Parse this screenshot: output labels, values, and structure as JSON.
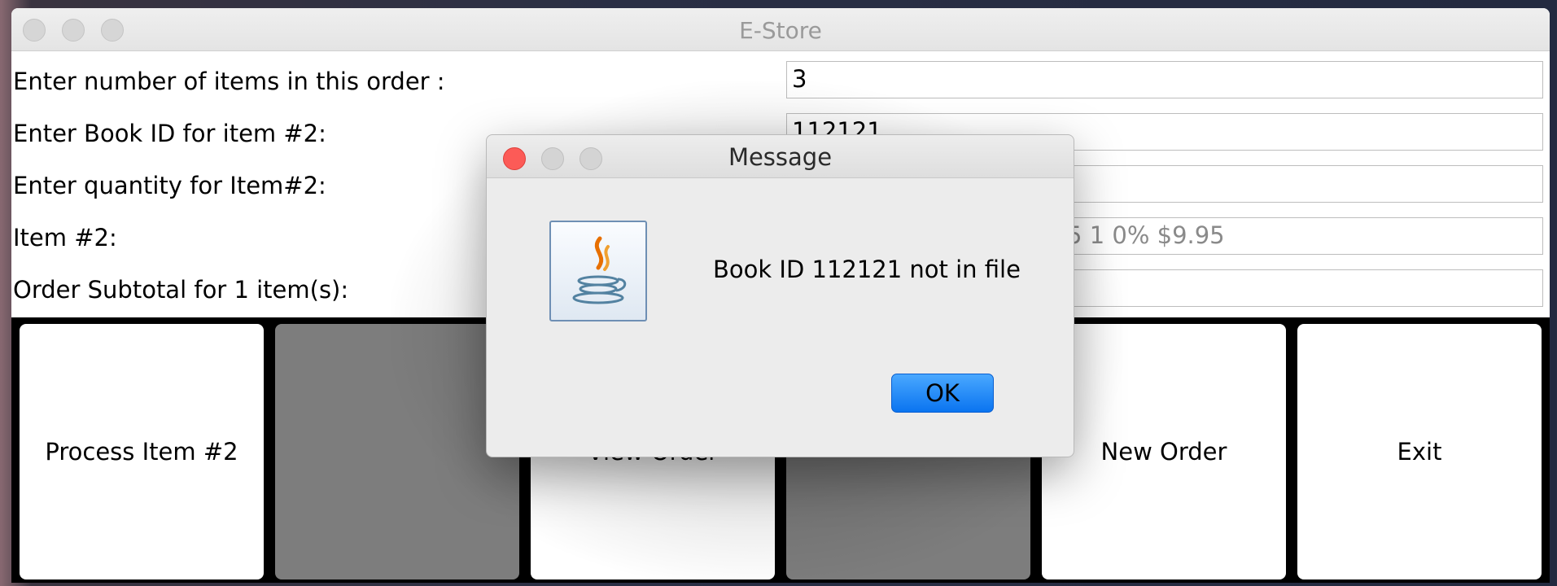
{
  "window": {
    "title": "E-Store"
  },
  "form": {
    "rows": [
      {
        "label": "Enter number of items in this order :",
        "value": "3"
      },
      {
        "label": "Enter Book ID for item #2:",
        "value": "112121"
      },
      {
        "label": "Enter quantity for Item#2:",
        "value": ""
      },
      {
        "label": "Item #2:",
        "value": "– Sue Grafton\" $9.95 1 0%  $9.95"
      },
      {
        "label": "Order Subtotal for 1 item(s):",
        "value": ""
      }
    ]
  },
  "buttons": {
    "process": "Process Item #2",
    "view_order": "View Order",
    "new_order": "New Order",
    "exit": "Exit"
  },
  "dialog": {
    "title": "Message",
    "message": "Book ID 112121 not in file",
    "ok_label": "OK",
    "icon": "java-icon"
  },
  "colors": {
    "ok_button": "#0a74f0",
    "close_light": "#fc5b57",
    "disabled_button": "#7d7d7d"
  }
}
